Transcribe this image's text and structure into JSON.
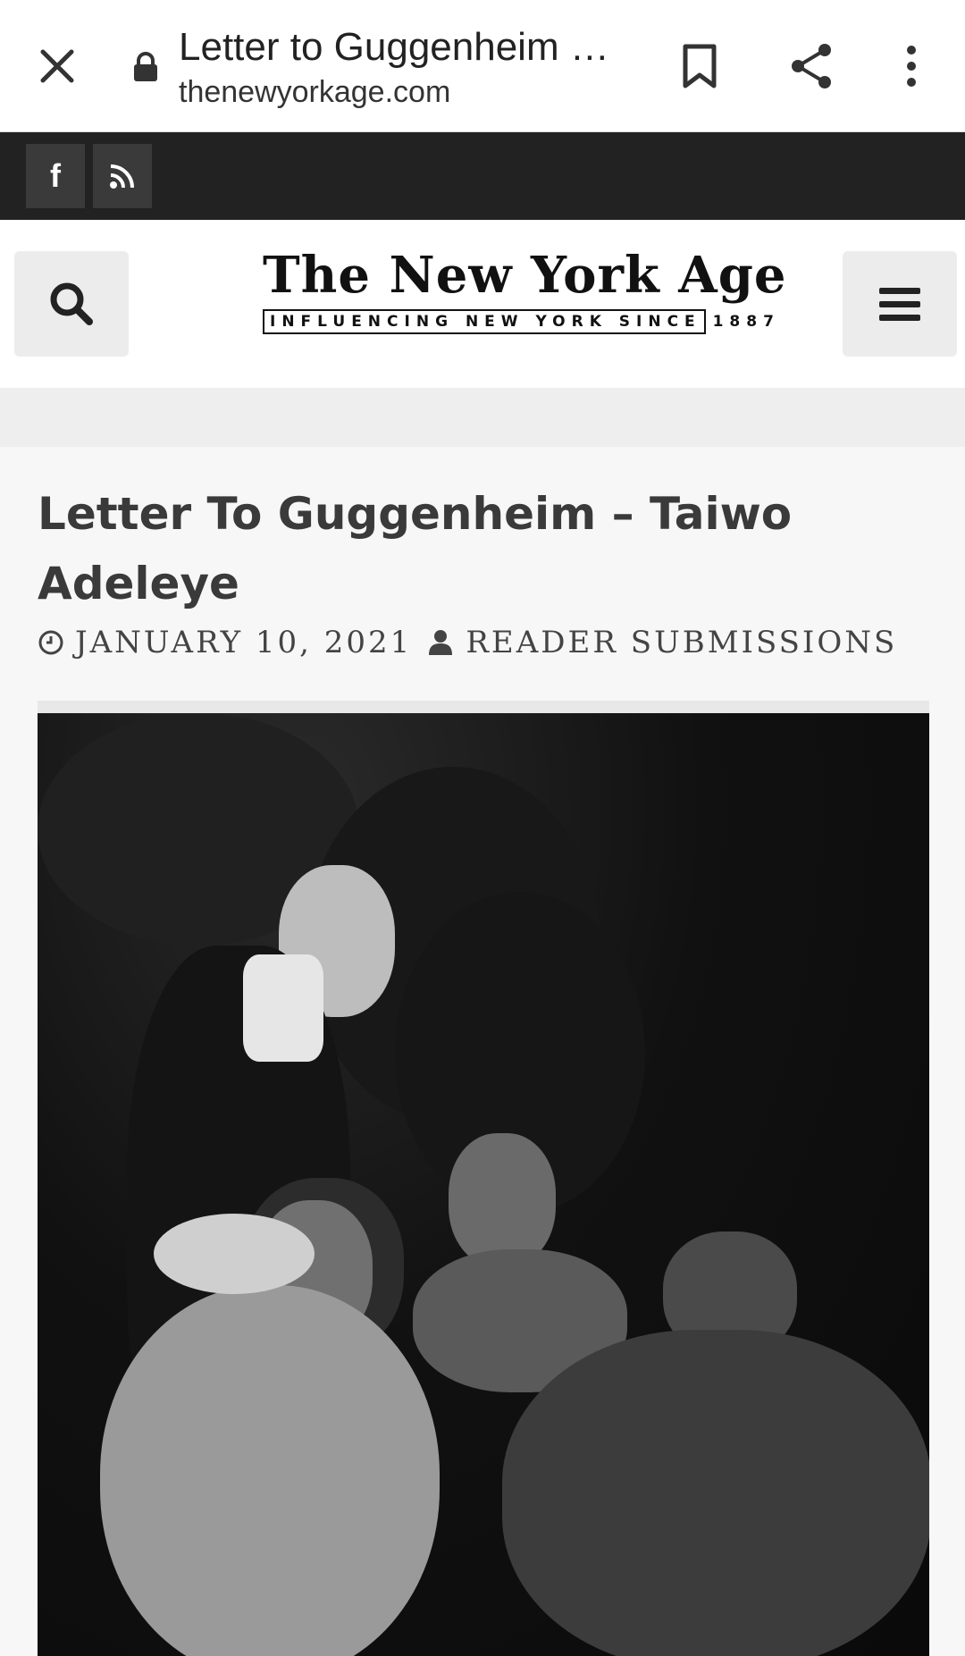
{
  "browser": {
    "tab_title": "Letter to Guggenheim …",
    "tab_url": "thenewyorkage.com",
    "icons": [
      "close-icon",
      "lock-icon",
      "bookmark-icon",
      "share-icon",
      "more-vert-icon"
    ]
  },
  "social": {
    "items": [
      {
        "icon": "facebook-icon",
        "glyph": "f"
      },
      {
        "icon": "rss-icon"
      }
    ]
  },
  "header": {
    "logo_main": "The New York Age",
    "logo_tagline": "INFLUENCING NEW YORK SINCE 1887",
    "icons": [
      "search-icon",
      "hamburger-menu-icon"
    ]
  },
  "article": {
    "title": "Letter To Guggenheim – Taiwo Adeleye",
    "date": "JANUARY 10, 2021",
    "author": "READER SUBMISSIONS"
  },
  "colors": {
    "social_bar": "#222222",
    "title_text": "#3a3a3a"
  }
}
